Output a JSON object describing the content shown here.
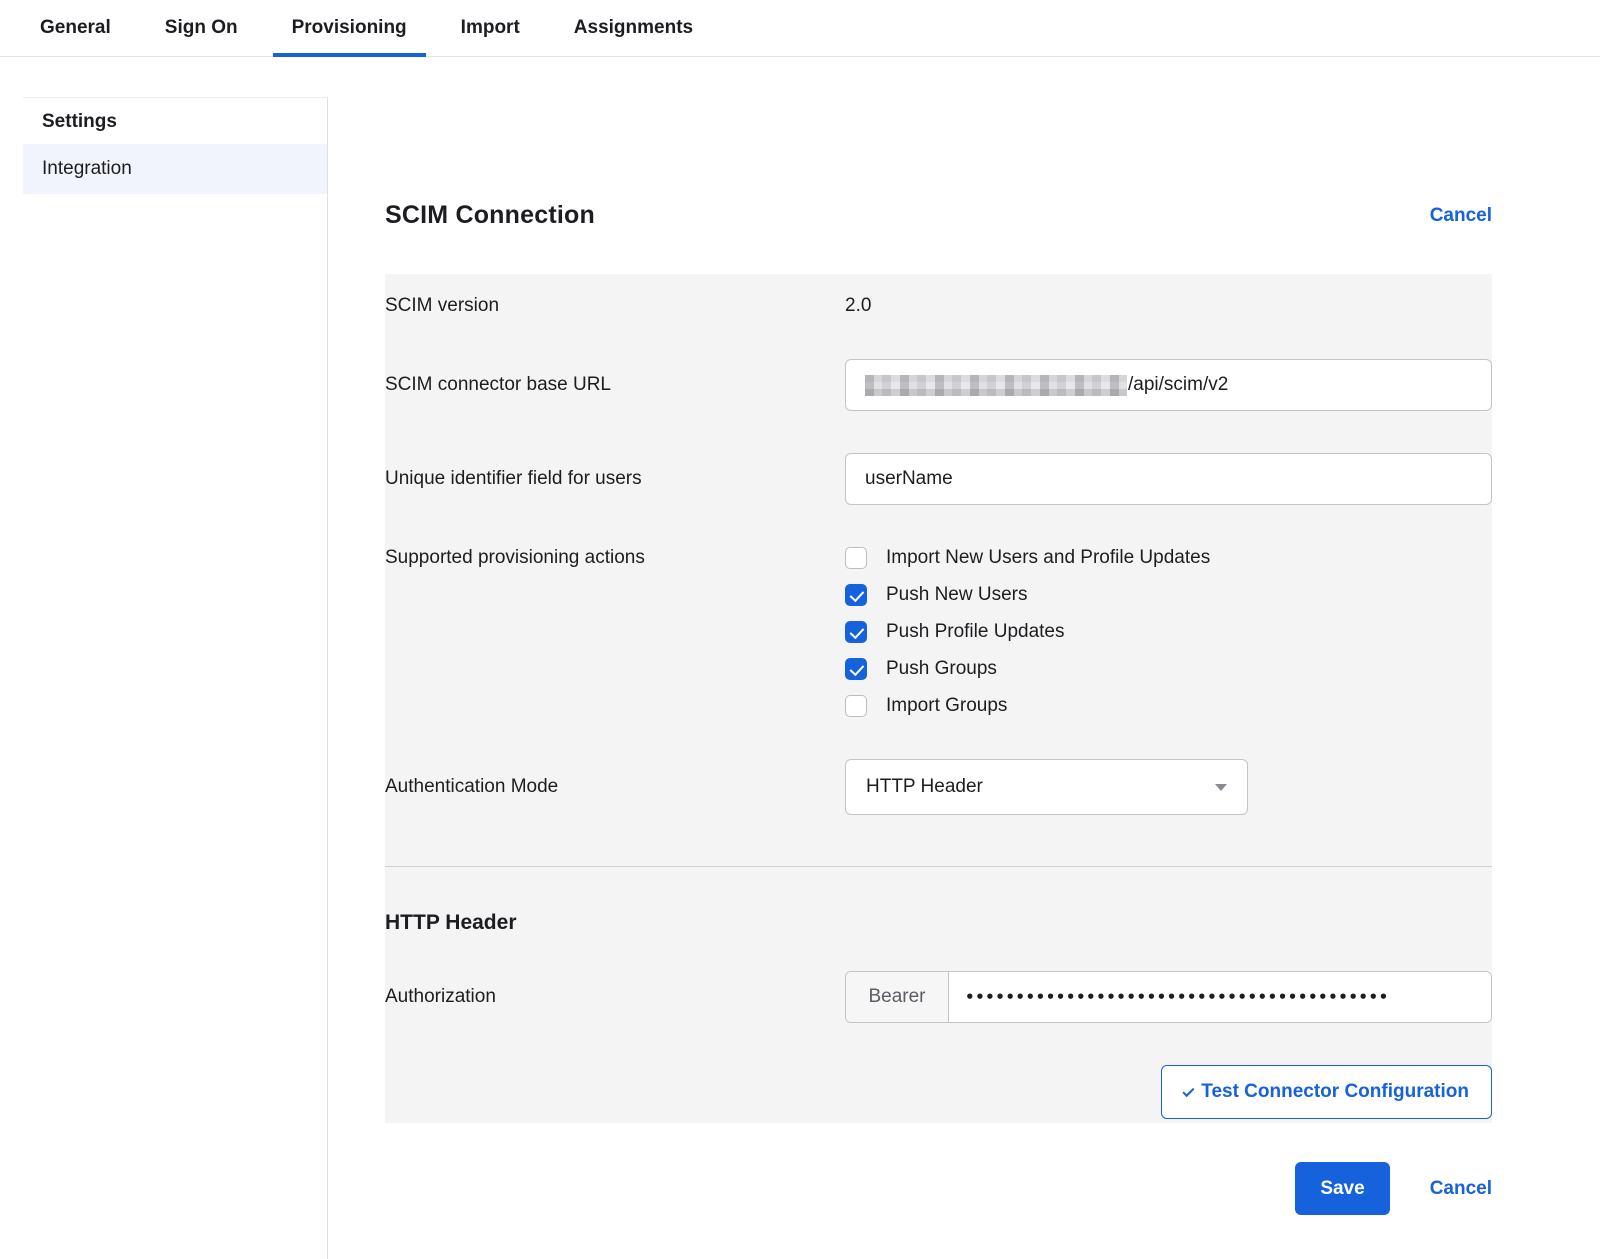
{
  "tabs": [
    {
      "label": "General",
      "active": false
    },
    {
      "label": "Sign On",
      "active": false
    },
    {
      "label": "Provisioning",
      "active": true
    },
    {
      "label": "Import",
      "active": false
    },
    {
      "label": "Assignments",
      "active": false
    }
  ],
  "sidebar": {
    "heading": "Settings",
    "items": [
      {
        "label": "Integration",
        "selected": true
      }
    ]
  },
  "main": {
    "title": "SCIM Connection",
    "cancel_top_label": "Cancel",
    "form": {
      "scim_version": {
        "label": "SCIM version",
        "value": "2.0"
      },
      "base_url": {
        "label": "SCIM connector base URL",
        "visible_suffix": "/api/scim/v2"
      },
      "unique_identifier": {
        "label": "Unique identifier field for users",
        "value": "userName"
      },
      "provisioning_actions": {
        "label": "Supported provisioning actions",
        "options": [
          {
            "label": "Import New Users and Profile Updates",
            "checked": false
          },
          {
            "label": "Push New Users",
            "checked": true
          },
          {
            "label": "Push Profile Updates",
            "checked": true
          },
          {
            "label": "Push Groups",
            "checked": true
          },
          {
            "label": "Import Groups",
            "checked": false
          }
        ]
      },
      "authentication_mode": {
        "label": "Authentication Mode",
        "value": "HTTP Header"
      }
    },
    "http_header": {
      "title": "HTTP Header",
      "authorization": {
        "label": "Authorization",
        "prefix": "Bearer",
        "masked_value": "••••••••••••••••••••••••••••••••••••••••••"
      },
      "test_button_label": "Test Connector Configuration"
    },
    "footer": {
      "save_label": "Save",
      "cancel_label": "Cancel"
    }
  },
  "colors": {
    "accent_blue": "#1662dd",
    "panel_gray": "#f4f4f4",
    "selected_item_bg": "#f1f4fc"
  }
}
